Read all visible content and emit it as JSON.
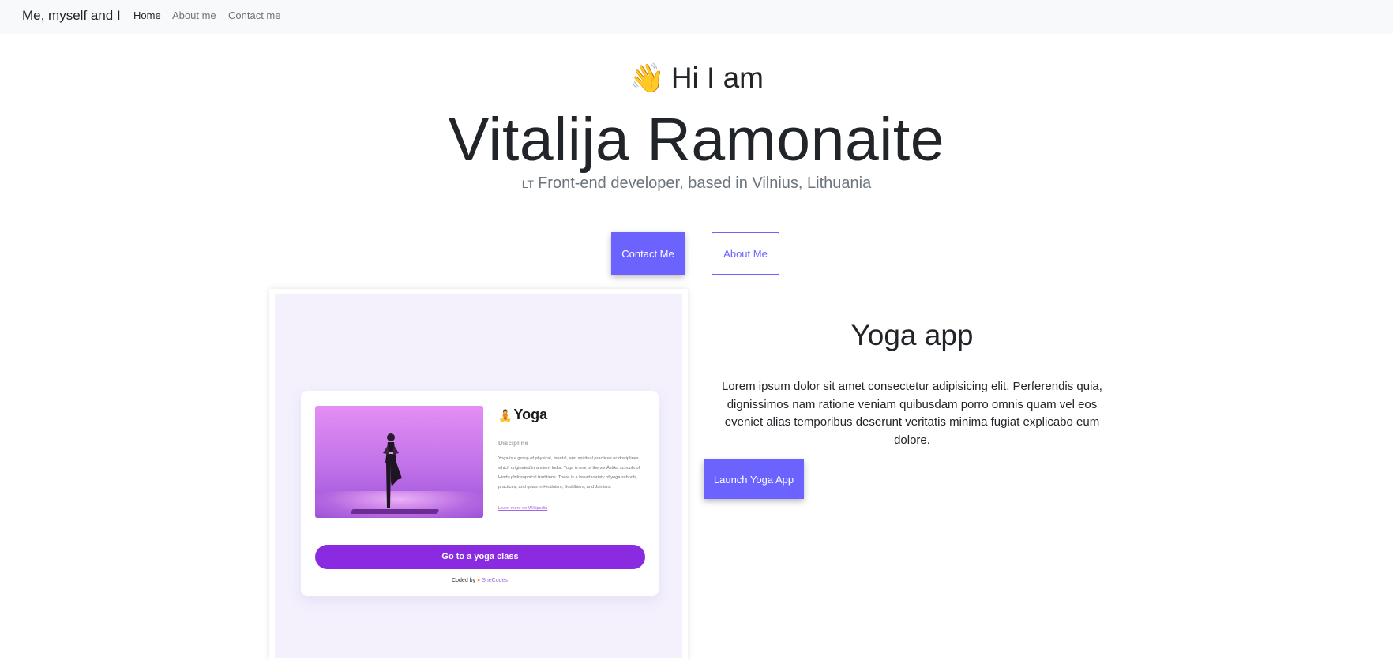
{
  "nav": {
    "brand": "Me, myself and I",
    "links": [
      {
        "label": "Home",
        "active": true
      },
      {
        "label": "About me",
        "active": false
      },
      {
        "label": "Contact me",
        "active": false
      }
    ]
  },
  "hero": {
    "wave_emoji": "👋",
    "greeting": "Hi I am",
    "name": "Vitalija Ramonaite",
    "flag_code": "LT",
    "subtitle": "Front-end developer, based in Vilnius, Lithuania",
    "contact_button": "Contact Me",
    "about_button": "About Me"
  },
  "project": {
    "title": "Yoga app",
    "description": "Lorem ipsum dolor sit amet consectetur adipisicing elit. Perferendis quia, dignissimos nam ratione veniam quibusdam porro omnis quam vel eos eveniet alias temporibus deserunt veritatis minima fugiat explicabo eum dolore.",
    "launch_button": "Launch Yoga App",
    "preview": {
      "app_emoji": "🧘",
      "app_title": "Yoga",
      "subheading": "Discipline",
      "text": "Yoga is a group of physical, mental, and spiritual practices or disciplines which originated in ancient India. Yoga is one of the six Āstika schools of Hindu philosophical traditions. There is a broad variety of yoga schools, practices, and goals in Hinduism, Buddhism, and Jainism.",
      "learn_more": "Learn more on Wikipedia",
      "cta": "Go to a yoga class",
      "coded_by": "Coded by",
      "coded_by_icon": "●",
      "coded_by_link": "SheCodes"
    }
  },
  "colors": {
    "accent": "#6c63ff",
    "yoga_purple": "#8a2be2",
    "navbar_bg": "#f8f9fa",
    "preview_bg": "#f4f1fd"
  }
}
